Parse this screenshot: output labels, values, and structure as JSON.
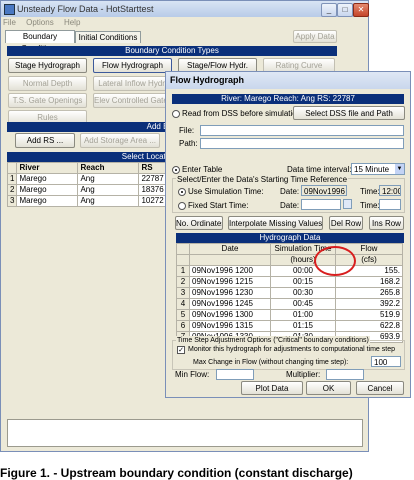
{
  "main_window": {
    "title": "Unsteady Flow Data - HotStarttest",
    "menu": [
      "File",
      "Options",
      "Help"
    ],
    "tabs": [
      "Boundary Conditions",
      "Initial Conditions"
    ],
    "apply_label": "Apply Data",
    "bc_types_header": "Boundary Condition Types",
    "bc_types": [
      "Stage Hydrograph",
      "Flow Hydrograph",
      "Stage/Flow Hydr.",
      "Rating Curve",
      "Normal Depth",
      "Lateral Inflow Hydr.",
      "",
      "",
      "T.S. Gate Openings",
      "Elev Controlled Gates",
      "",
      "",
      "Rules"
    ],
    "add_boundary_header": "Add Boundary",
    "add_rs_label": "Add RS ...",
    "add_storage_label": "Add Storage Area ...",
    "locations_header": "Select Location in table then",
    "table_headers": [
      "",
      "River",
      "Reach",
      "RS"
    ],
    "rows": [
      {
        "n": "1",
        "river": "Marego",
        "reach": "Ang",
        "rs": "22787"
      },
      {
        "n": "2",
        "river": "Marego",
        "reach": "Ang",
        "rs": "18376"
      },
      {
        "n": "3",
        "river": "Marego",
        "reach": "Ang",
        "rs": "10272"
      }
    ]
  },
  "dialog": {
    "title": "Flow Hydrograph",
    "location": "River: Marego  Reach: Ang  RS: 22787",
    "read_dss_label": "Read from DSS before simulation",
    "select_dss_label": "Select DSS file and Path",
    "file_label": "File:",
    "path_label": "Path:",
    "enter_table_label": "Enter Table",
    "interval_label": "Data time interval:",
    "interval_value": "15 Minute",
    "reference_group": "Select/Enter the Data's Starting Time Reference",
    "use_sim_label": "Use Simulation Time:",
    "date_label": "Date:",
    "date_value": "09Nov1996",
    "time_label": "Time:",
    "time_value": "12:00",
    "fixed_start_label": "Fixed Start Time:",
    "no_ordinates_label": "No. Ordinates",
    "interpolate_label": "Interpolate Missing Values",
    "del_row_label": "Del Row",
    "ins_row_label": "Ins Row",
    "hydrograph_header": "Hydrograph Data",
    "col_headers": [
      "",
      "Date",
      "Simulation Time",
      "Flow"
    ],
    "col_units": [
      "",
      "",
      "(hours)",
      "(cfs)"
    ],
    "rows": [
      {
        "n": "1",
        "date": "09Nov1996 1200",
        "time": "00:00",
        "flow": "155."
      },
      {
        "n": "2",
        "date": "09Nov1996 1215",
        "time": "00:15",
        "flow": "168.2"
      },
      {
        "n": "3",
        "date": "09Nov1996 1230",
        "time": "00:30",
        "flow": "265.8"
      },
      {
        "n": "4",
        "date": "09Nov1996 1245",
        "time": "00:45",
        "flow": "392.2"
      },
      {
        "n": "5",
        "date": "09Nov1996 1300",
        "time": "01:00",
        "flow": "519.9"
      },
      {
        "n": "6",
        "date": "09Nov1996 1315",
        "time": "01:15",
        "flow": "622.8"
      },
      {
        "n": "7",
        "date": "09Nov1996 1330",
        "time": "01:30",
        "flow": "693.9"
      }
    ],
    "tsa_group": "Time Step Adjustment Options (\"Critical\" boundary conditions)",
    "monitor_label": "Monitor this hydrograph for adjustments to computational time step",
    "max_change_label": "Max Change in Flow (without changing time step):",
    "max_change_value": "100",
    "min_flow_label": "Min Flow:",
    "multiplier_label": "Multiplier:",
    "plot_label": "Plot Data",
    "ok_label": "OK",
    "cancel_label": "Cancel"
  },
  "caption": "Figure 1. - Upstream boundary condition (constant discharge)"
}
